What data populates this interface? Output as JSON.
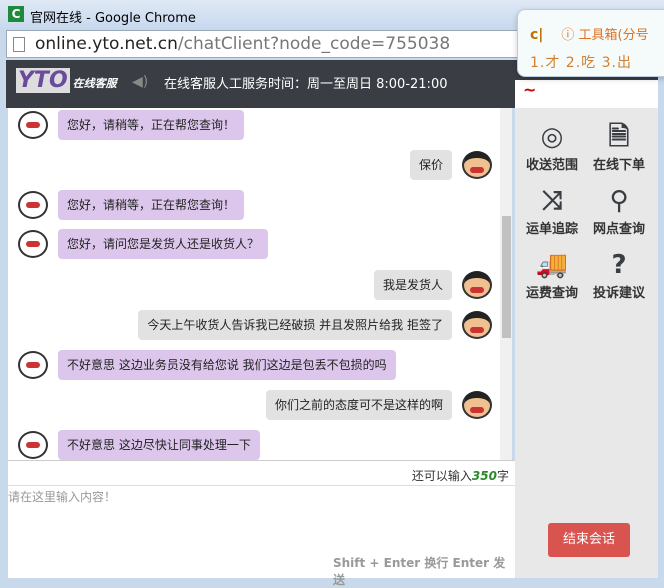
{
  "window": {
    "title": "官网在线 - Google Chrome",
    "app_icon": "C"
  },
  "address": {
    "host": "online.yto.net.cn",
    "path": "/chatClient?node_code=755038"
  },
  "header": {
    "logo_text": "YTO",
    "logo_sub": "在线客服",
    "hours": "在线客服人工服务时间：周一至周日 8:00-21:00"
  },
  "ime": {
    "input": "c|",
    "toolbox": "ⓘ 工具箱(分号",
    "candidates": "1.才  2.吃  3.出"
  },
  "messages": [
    {
      "side": "left",
      "text": "您好，请稍等，正在帮您查询！"
    },
    {
      "side": "right",
      "text": "保价"
    },
    {
      "side": "left",
      "text": "您好，请稍等，正在帮您查询！"
    },
    {
      "side": "left",
      "text": "您好，请问您是发货人还是收货人？"
    },
    {
      "side": "right",
      "text": "我是发货人"
    },
    {
      "side": "right",
      "text": "今天上午收货人告诉我已经破损 并且发照片给我  拒签了"
    },
    {
      "side": "left",
      "text": "不好意思 这边业务员没有给您说 我们这边是包丢不包损的吗"
    },
    {
      "side": "right",
      "text": "你们之前的态度可不是这样的啊"
    },
    {
      "side": "left",
      "text": "不好意思 这边尽快让同事处理一下"
    }
  ],
  "sidebar": {
    "items": [
      {
        "label": "收送范围",
        "icon": "compass-icon",
        "glyph": "◎"
      },
      {
        "label": "在线下单",
        "icon": "document-icon",
        "glyph": "🗎"
      },
      {
        "label": "运单追踪",
        "icon": "shuffle-icon",
        "glyph": "⤨"
      },
      {
        "label": "网点查询",
        "icon": "search-icon",
        "glyph": "⚲"
      },
      {
        "label": "运费查询",
        "icon": "truck-icon",
        "glyph": "🚚"
      },
      {
        "label": "投诉建议",
        "icon": "question-icon",
        "glyph": "?"
      }
    ]
  },
  "input": {
    "counter_prefix": "还可以输入",
    "counter_value": "350",
    "counter_suffix": "字",
    "placeholder": "请在这里输入内容！",
    "hint": "Shift + Enter 换行  Enter 发送"
  },
  "end_button": "结束会话"
}
